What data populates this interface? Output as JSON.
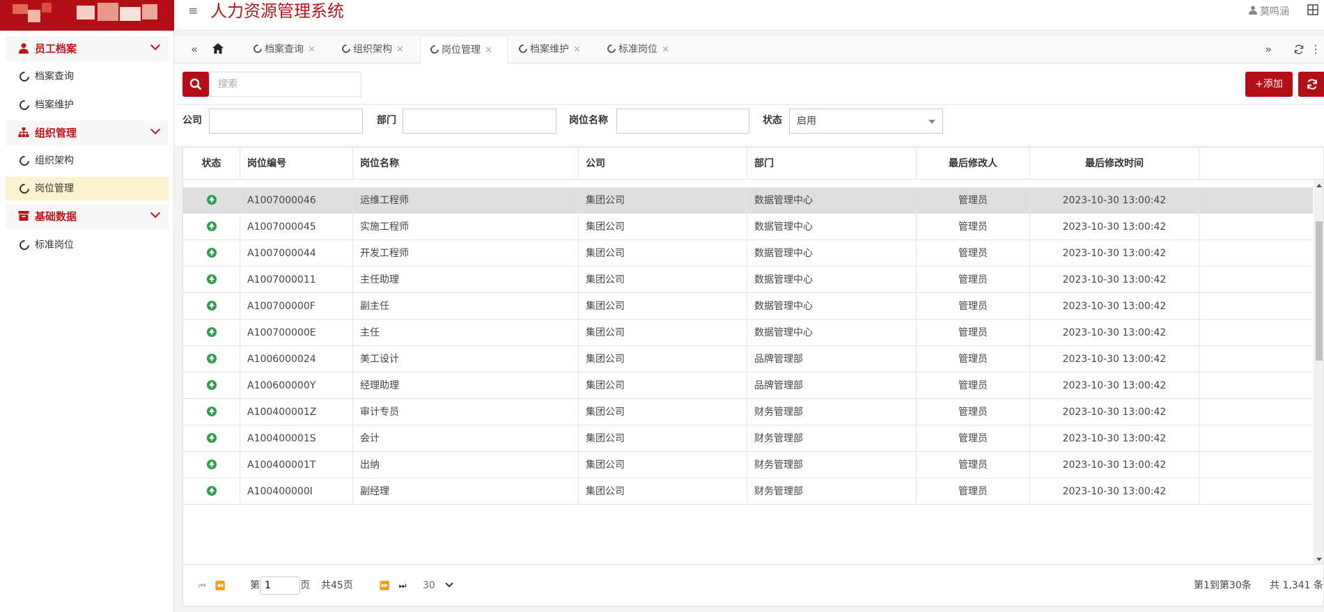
{
  "header": {
    "title": "人力资源管理系统",
    "user_name": "莫鸣涵"
  },
  "sidebar": {
    "groups": [
      {
        "label": "员工档案",
        "icon": "user-icon",
        "items": [
          {
            "label": "档案查询"
          },
          {
            "label": "档案维护"
          }
        ]
      },
      {
        "label": "组织管理",
        "icon": "sitemap-icon",
        "items": [
          {
            "label": "组织架构"
          },
          {
            "label": "岗位管理",
            "active": true
          }
        ]
      },
      {
        "label": "基础数据",
        "icon": "archive-icon",
        "items": [
          {
            "label": "标准岗位"
          }
        ]
      }
    ]
  },
  "tabs": [
    {
      "label": "档案查询"
    },
    {
      "label": "组织架构"
    },
    {
      "label": "岗位管理",
      "active": true
    },
    {
      "label": "档案维护"
    },
    {
      "label": "标准岗位"
    }
  ],
  "toolbar": {
    "search_placeholder": "搜索",
    "add_label": "+添加"
  },
  "filters": {
    "company_label": "公司",
    "company_value": "",
    "dept_label": "部门",
    "dept_value": "",
    "position_label": "岗位名称",
    "position_value": "",
    "status_label": "状态",
    "status_value": "启用"
  },
  "table": {
    "columns": [
      "状态",
      "岗位编号",
      "岗位名称",
      "公司",
      "部门",
      "最后修改人",
      "最后修改时间"
    ],
    "rows": [
      {
        "code": "A1007000046",
        "name": "运维工程师",
        "company": "集团公司",
        "dept": "数据管理中心",
        "modifier": "管理员",
        "time": "2023-10-30 13:00:42"
      },
      {
        "code": "A1007000045",
        "name": "实施工程师",
        "company": "集团公司",
        "dept": "数据管理中心",
        "modifier": "管理员",
        "time": "2023-10-30 13:00:42"
      },
      {
        "code": "A1007000044",
        "name": "开发工程师",
        "company": "集团公司",
        "dept": "数据管理中心",
        "modifier": "管理员",
        "time": "2023-10-30 13:00:42"
      },
      {
        "code": "A1007000011",
        "name": "主任助理",
        "company": "集团公司",
        "dept": "数据管理中心",
        "modifier": "管理员",
        "time": "2023-10-30 13:00:42"
      },
      {
        "code": "A100700000F",
        "name": "副主任",
        "company": "集团公司",
        "dept": "数据管理中心",
        "modifier": "管理员",
        "time": "2023-10-30 13:00:42"
      },
      {
        "code": "A100700000E",
        "name": "主任",
        "company": "集团公司",
        "dept": "数据管理中心",
        "modifier": "管理员",
        "time": "2023-10-30 13:00:42"
      },
      {
        "code": "A1006000024",
        "name": "美工设计",
        "company": "集团公司",
        "dept": "品牌管理部",
        "modifier": "管理员",
        "time": "2023-10-30 13:00:42"
      },
      {
        "code": "A100600000Y",
        "name": "经理助理",
        "company": "集团公司",
        "dept": "品牌管理部",
        "modifier": "管理员",
        "time": "2023-10-30 13:00:42"
      },
      {
        "code": "A100400001Z",
        "name": "审计专员",
        "company": "集团公司",
        "dept": "财务管理部",
        "modifier": "管理员",
        "time": "2023-10-30 13:00:42"
      },
      {
        "code": "A100400001S",
        "name": "会计",
        "company": "集团公司",
        "dept": "财务管理部",
        "modifier": "管理员",
        "time": "2023-10-30 13:00:42"
      },
      {
        "code": "A100400001T",
        "name": "出纳",
        "company": "集团公司",
        "dept": "财务管理部",
        "modifier": "管理员",
        "time": "2023-10-30 13:00:42"
      },
      {
        "code": "A100400000I",
        "name": "副经理",
        "company": "集团公司",
        "dept": "财务管理部",
        "modifier": "管理员",
        "time": "2023-10-30 13:00:42"
      }
    ]
  },
  "pager": {
    "page_prefix": "第",
    "page_value": "1",
    "page_suffix": "页",
    "total_pages": "共45页",
    "page_size": "30",
    "range_text": "第1到第30条",
    "total_text": "共 1,341 条"
  }
}
